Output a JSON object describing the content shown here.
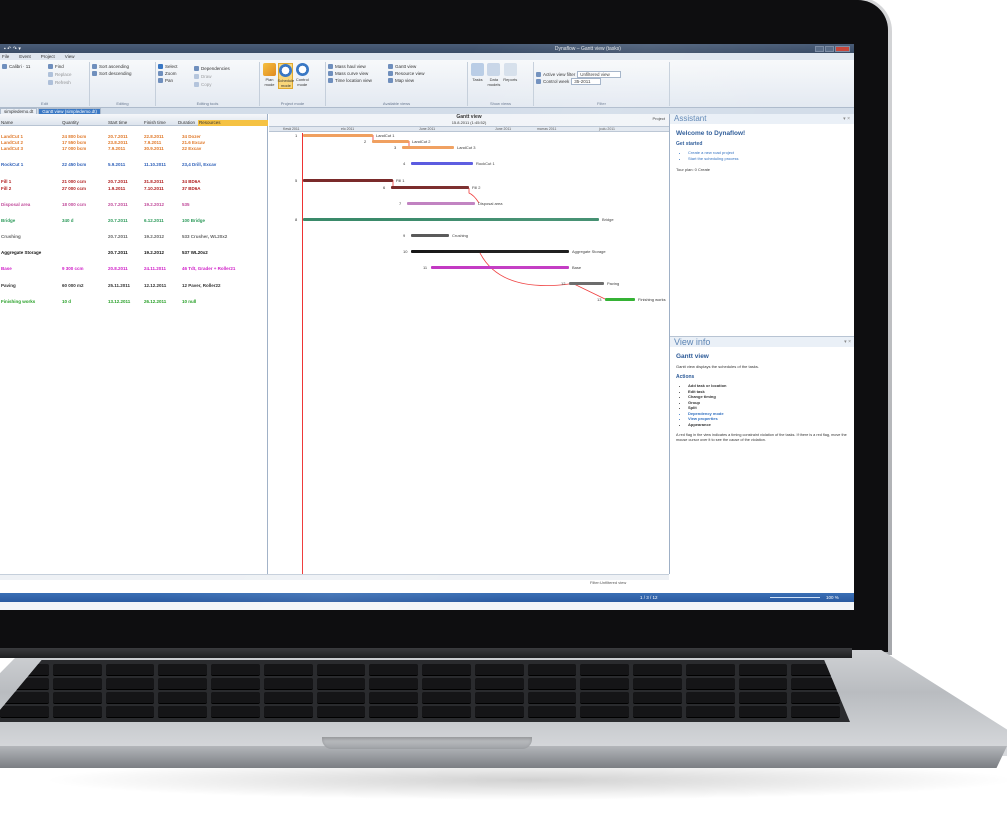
{
  "app": {
    "window_title": "Dynaflow – Gantt view (tasks)",
    "menus": [
      "File",
      "Event",
      "Project",
      "View"
    ]
  },
  "ribbon": {
    "groups": [
      {
        "label": "Edit",
        "buttons": [
          "Find",
          "Replace",
          "Refresh"
        ]
      },
      {
        "label": "Editing",
        "buttons": [
          "Sort ascending",
          "Sort descending",
          "Select",
          "Zoom",
          "Pan"
        ]
      },
      {
        "label": "Editing tools",
        "buttons": [
          "Dependencies",
          "Draw",
          "Copy"
        ]
      },
      {
        "label": "Project mode",
        "buttons": [
          "Plan mode",
          "Schedule mode",
          "Control mode"
        ]
      },
      {
        "label": "Available views",
        "buttons": [
          "Mass haul view",
          "Gantt view",
          "Mass curve view",
          "Resource view",
          "Time location view",
          "Map view"
        ]
      },
      {
        "label": "Show views",
        "buttons": [
          "Tasks",
          "Data models",
          "Reports"
        ]
      },
      {
        "label": "Filter",
        "fields": [
          {
            "label": "Active view filter",
            "value": "Unfiltered view"
          },
          {
            "label": "Control week",
            "value": "35-2011"
          }
        ]
      }
    ]
  },
  "tabs": [
    "simpledemo.dt",
    "Gantt view (simpledemo.dt)"
  ],
  "grid": {
    "headers": [
      "Name",
      "Quantity",
      "Start time",
      "Finish time",
      "Duration",
      "Resources"
    ],
    "rows": [
      {
        "name": "LandCut 1",
        "qty": "24 800 bcm",
        "start": "20.7.2011",
        "finish": "22.8.2011",
        "res": "34 Dozer",
        "color": "#e07828"
      },
      {
        "name": "LandCut 2",
        "qty": "17 550 bcm",
        "start": "23.8.2011",
        "finish": "7.9.2011",
        "res": "21.6 Excav",
        "color": "#e07828"
      },
      {
        "name": "LandCut 3",
        "qty": "17 000 bcm",
        "start": "7.9.2011",
        "finish": "30.9.2011",
        "res": "22 Excav",
        "color": "#e07828"
      },
      {
        "name": "RockCut 1",
        "qty": "22 450 bcm",
        "start": "5.9.2011",
        "finish": "11.10.2011",
        "res": "23,4 Drill, Excav",
        "color": "#2d5fb8"
      },
      {
        "name": "Fill 1",
        "qty": "21 000 ccm",
        "start": "20.7.2011",
        "finish": "31.8.2011",
        "res": "34 BD6A",
        "color": "#b01e1e"
      },
      {
        "name": "Fill 2",
        "qty": "27 000 ccm",
        "start": "1.9.2011",
        "finish": "7.10.2011",
        "res": "37 BD6A",
        "color": "#b01e1e"
      },
      {
        "name": "Disposal area",
        "qty": "18 000 ccm",
        "start": "20.7.2011",
        "finish": "19.2.2012",
        "res": "535",
        "color": "#c04a9a"
      },
      {
        "name": "Bridge",
        "qty": "340 d",
        "start": "20.7.2011",
        "finish": "6.12.2011",
        "res": "100 Bridge",
        "color": "#2c9a5a"
      },
      {
        "name": "Crushing",
        "qty": "",
        "start": "20.7.2011",
        "finish": "19.2.2012",
        "res": "533 Crusher, WL20x2",
        "color": "#666666"
      },
      {
        "name": "Aggregate Storage",
        "qty": "",
        "start": "20.7.2011",
        "finish": "19.2.2012",
        "res": "537 WL20x2",
        "color": "#111111"
      },
      {
        "name": "Base",
        "qty": "9 300 ccm",
        "start": "20.8.2011",
        "finish": "24.11.2011",
        "res": "46 Tdt, Grader + Roller21",
        "color": "#d020c8"
      },
      {
        "name": "Paving",
        "qty": "60 000 m2",
        "start": "25.11.2011",
        "finish": "12.12.2011",
        "res": "12 Paver, Roller22",
        "color": "#333333"
      },
      {
        "name": "Finishing works",
        "qty": "10 d",
        "start": "13.12.2011",
        "finish": "26.12.2011",
        "res": "10 null",
        "color": "#28a028"
      }
    ]
  },
  "gantt": {
    "title": "Gantt view",
    "subtitle": "15.8.2011 (1:45:52)",
    "project_label": "Project",
    "months": [
      "Kesä 2011",
      "elo 2011",
      "June 2011",
      "June 2011",
      "marras 2011",
      "joulu 2011"
    ],
    "bars": [
      {
        "label": "LandCut 1",
        "num": "1",
        "color": "#f0a060"
      },
      {
        "label": "LandCut 2",
        "num": "2",
        "color": "#f0a060"
      },
      {
        "label": "LandCut 3",
        "num": "3",
        "color": "#f0a060"
      },
      {
        "label": "RockCut 1",
        "num": "4",
        "color": "#5a5ae0"
      },
      {
        "label": "Fill 1",
        "num": "5",
        "color": "#7a2a2a"
      },
      {
        "label": "Fill 2",
        "num": "6",
        "color": "#7a2a2a"
      },
      {
        "label": "Disposal area",
        "num": "7",
        "color": "#c080c0"
      },
      {
        "label": "Bridge",
        "num": "8",
        "color": "#3a8a6a"
      },
      {
        "label": "Crushing",
        "num": "9",
        "color": "#555555"
      },
      {
        "label": "Aggregate Storage",
        "num": "10",
        "color": "#111111"
      },
      {
        "label": "Base",
        "num": "11",
        "color": "#c030c0"
      },
      {
        "label": "Paving",
        "num": "12",
        "color": "#666666"
      },
      {
        "label": "Finishing works",
        "num": "13",
        "color": "#30b030"
      }
    ]
  },
  "assistant": {
    "title": "Assistant",
    "heading": "Welcome to Dynaflow!",
    "subheading": "Get started",
    "links": [
      "Create a new road project",
      "Start the scheduling process"
    ],
    "footer": "Tour plan: 0 Create"
  },
  "viewinfo": {
    "title": "View info",
    "heading": "Gantt view",
    "desc": "Gantt view displays the schedules of the tasks.",
    "actions_title": "Actions",
    "actions": [
      "Add task or location",
      "Edit task",
      "Change timing",
      "Group",
      "Split",
      "Dependency mode",
      "View properties",
      "Appearance"
    ],
    "note": "A red flag in the view indicates a timing constraint violation of the tasks. If there is a red flag, move the mouse cursor over it to see the cause of the violation."
  },
  "status": {
    "left": "",
    "right_count": "1 / 3 / 12",
    "zoom": "100 %",
    "filter_label": "Filter:Unfiltered view"
  }
}
